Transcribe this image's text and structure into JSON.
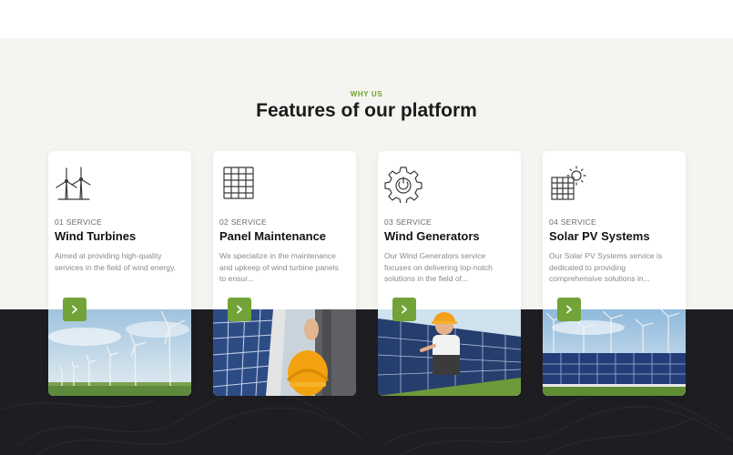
{
  "section": {
    "eyebrow": "WHY US",
    "title": "Features of our platform"
  },
  "colors": {
    "accent": "#72a338",
    "light_band": "#f4f4f1",
    "dark_band": "#1e1e22"
  },
  "cards": [
    {
      "number": "01 SERVICE",
      "title": "Wind Turbines",
      "description": "Aimed at providing high-quality services in the field of wind energy.",
      "icon": "wind-turbines-icon",
      "photo": "wind-farm-photo"
    },
    {
      "number": "02 SERVICE",
      "title": "Panel Maintenance",
      "description": "We specialize in the maintenance and upkeep of wind turbine panels to ensur...",
      "icon": "solar-panel-icon",
      "photo": "worker-with-helmet-photo"
    },
    {
      "number": "03 SERVICE",
      "title": "Wind Generators",
      "description": "Our Wind Generators service focuses on delivering top-notch solutions in the field of...",
      "icon": "gear-power-icon",
      "photo": "technician-at-panels-photo"
    },
    {
      "number": "04 SERVICE",
      "title": "Solar PV Systems",
      "description": "Our Solar PV Systems service is dedicated to providing comprehensive solutions in...",
      "icon": "sun-panel-icon",
      "photo": "solar-field-with-turbines-photo"
    }
  ]
}
